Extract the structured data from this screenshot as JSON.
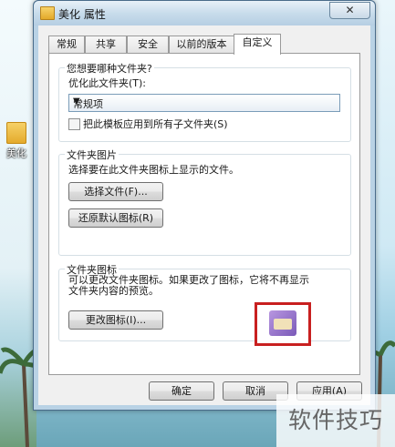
{
  "window": {
    "title": "美化 属性",
    "close_glyph": "✕"
  },
  "desktop": {
    "icon_label": "美化"
  },
  "tabs": [
    {
      "label": "常规"
    },
    {
      "label": "共享"
    },
    {
      "label": "安全"
    },
    {
      "label": "以前的版本"
    },
    {
      "label": "自定义"
    }
  ],
  "optimize": {
    "group_title": "您想要哪种文件夹?",
    "label": "优化此文件夹(T):",
    "combo_value": "常规项",
    "checkbox_label": "把此模板应用到所有子文件夹(S)",
    "checked": false
  },
  "folder_picture": {
    "group_title": "文件夹图片",
    "description": "选择要在此文件夹图标上显示的文件。",
    "choose_button": "选择文件(F)...",
    "restore_button": "还原默认图标(R)"
  },
  "folder_icon": {
    "group_title": "文件夹图标",
    "description_line1": "可以更改文件夹图标。如果更改了图标，它将不再显示",
    "description_line2": "文件夹内容的预览。",
    "change_button": "更改图标(I)..."
  },
  "footer": {
    "ok": "确定",
    "cancel": "取消",
    "apply": "应用(A)"
  },
  "watermark": "软件技巧"
}
